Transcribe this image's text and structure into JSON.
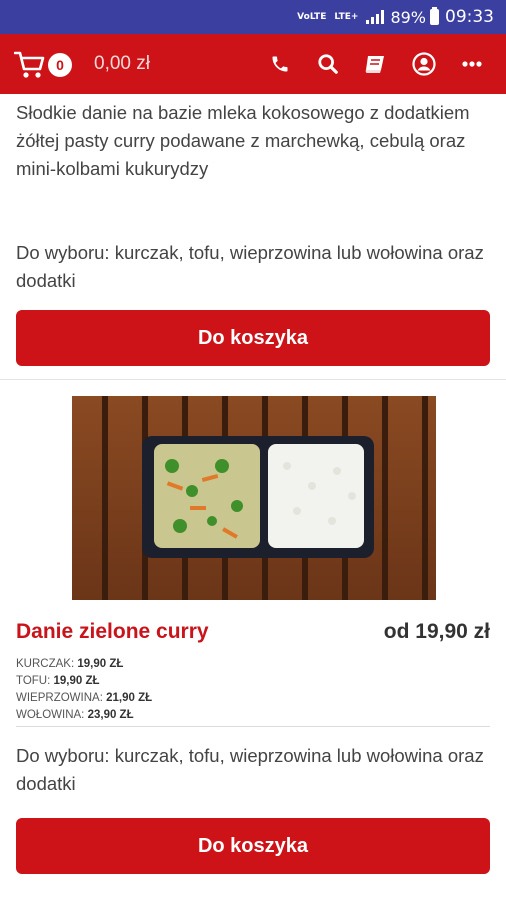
{
  "status_bar": {
    "network_top": "VoLTE",
    "network_lte": "LTE+",
    "battery": "89%",
    "time": "09:33"
  },
  "app_bar": {
    "cart_count": "0",
    "cart_total": "0,00 zł",
    "icons": [
      "phone-icon",
      "search-icon",
      "book-icon",
      "user-icon",
      "more-icon"
    ]
  },
  "products": [
    {
      "description": "Słodkie danie na bazie mleka kokosowego z dodatkiem żółtej pasty curry podawane z marchewką, cebulą oraz mini-kolbami kukurydzy",
      "options": "Do wyboru: kurczak, tofu, wieprzowina lub wołowina oraz dodatki",
      "button": "Do koszyka"
    },
    {
      "name": "Danie zielone curry",
      "price": "od 19,90 zł",
      "variants": [
        {
          "label": "KURCZAK:",
          "price": "19,90 ZŁ"
        },
        {
          "label": "TOFU:",
          "price": "19,90 ZŁ"
        },
        {
          "label": "WIEPRZOWINA:",
          "price": "21,90 ZŁ"
        },
        {
          "label": "WOŁOWINA:",
          "price": "23,90 ZŁ"
        }
      ],
      "options": "Do wyboru: kurczak, tofu, wieprzowina lub wołowina oraz dodatki",
      "button": "Do koszyka"
    }
  ],
  "colors": {
    "brand_red": "#cd1317",
    "status_bar": "#3b3fa0"
  }
}
